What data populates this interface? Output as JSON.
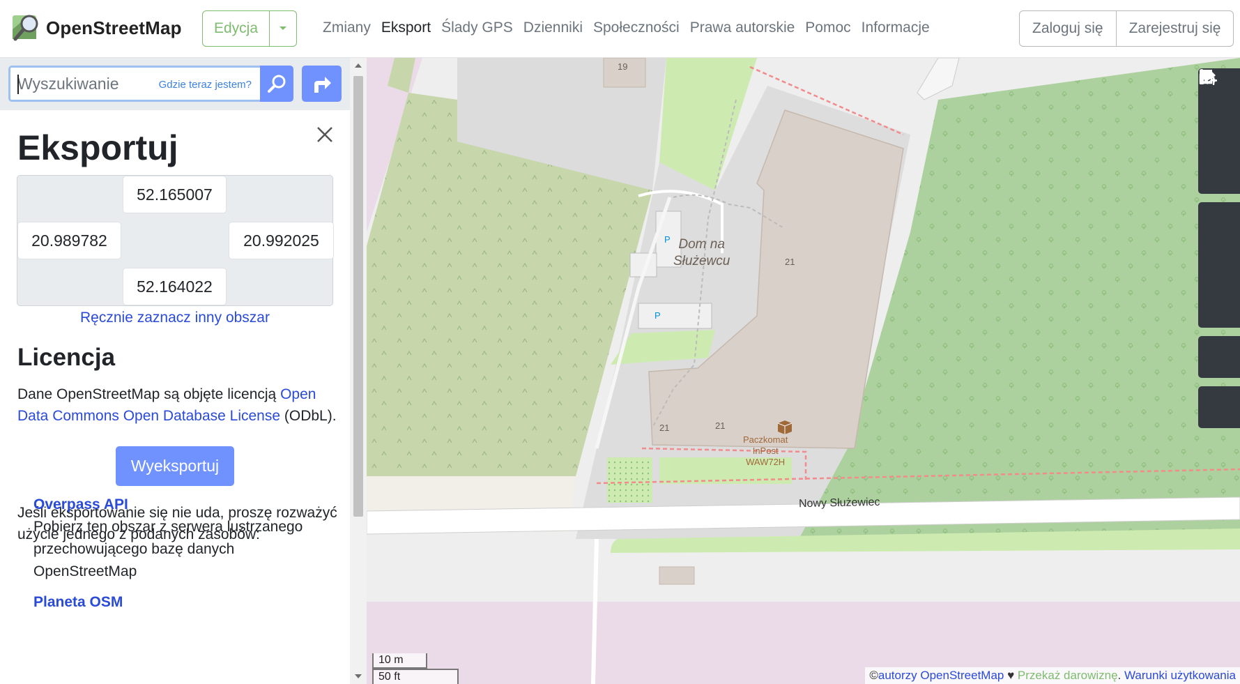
{
  "header": {
    "logo_text": "OpenStreetMap",
    "edit_label": "Edycja",
    "nav": [
      {
        "label": "Zmiany",
        "active": false
      },
      {
        "label": "Eksport",
        "active": true
      },
      {
        "label": "Ślady GPS",
        "active": false
      },
      {
        "label": "Dzienniki",
        "active": false
      },
      {
        "label": "Społeczności",
        "active": false
      },
      {
        "label": "Prawa autorskie",
        "active": false
      },
      {
        "label": "Pomoc",
        "active": false
      },
      {
        "label": "Informacje",
        "active": false
      }
    ],
    "login_label": "Zaloguj się",
    "register_label": "Zarejestruj się"
  },
  "search": {
    "placeholder": "Wyszukiwanie",
    "where_am_i": "Gdzie teraz jestem?"
  },
  "export_panel": {
    "title": "Eksportuj",
    "bbox": {
      "top": "52.165007",
      "left": "20.989782",
      "right": "20.992025",
      "bottom": "52.164022"
    },
    "manual_select": "Ręcznie zaznacz inny obszar",
    "license_title": "Licencja",
    "license_text_before": "Dane OpenStreetMap są objęte licencją ",
    "license_link": "Open Data Commons Open Database License",
    "license_text_after": " (ODbL).",
    "export_button": "Wyeksportuj",
    "fallback_text": "Jeśli eksportowanie się nie uda, proszę rozważyć użycie jednego z podanych zasobów:",
    "resources": [
      {
        "title": "Overpass API",
        "desc": "Pobierz ten obszar z serwera lustrzanego przechowującego bazę danych OpenStreetMap"
      },
      {
        "title": "Planeta OSM",
        "desc": ""
      }
    ]
  },
  "map": {
    "labels": {
      "building_name": [
        "Dom na",
        "Służewcu"
      ],
      "street": "Nowy Służewiec",
      "parcel_locker": [
        "Paczkomat",
        "InPost",
        "WAW72H"
      ],
      "house_numbers": [
        "19",
        "21",
        "21",
        "21"
      ],
      "parking": "P"
    },
    "scale_m": "10 m",
    "scale_ft": "50 ft",
    "attribution": {
      "copyright": "©",
      "authors": "autorzy OpenStreetMap",
      "heart": " ♥ ",
      "donate": "Przekaż darowiznę",
      "sep": ". ",
      "terms": "Warunki użytkowania"
    },
    "controls": [
      "zoom-in",
      "zoom-out",
      "locate",
      "layers",
      "map-key",
      "share",
      "add-note",
      "query-features"
    ]
  },
  "colors": {
    "accent": "#7092ff",
    "osm_green": "#7ebc6f",
    "link": "#2a4ad9",
    "control_bg": "#343a40",
    "building": "#d9d0c9",
    "forest": "#add19e",
    "grass": "#cdebb0"
  }
}
